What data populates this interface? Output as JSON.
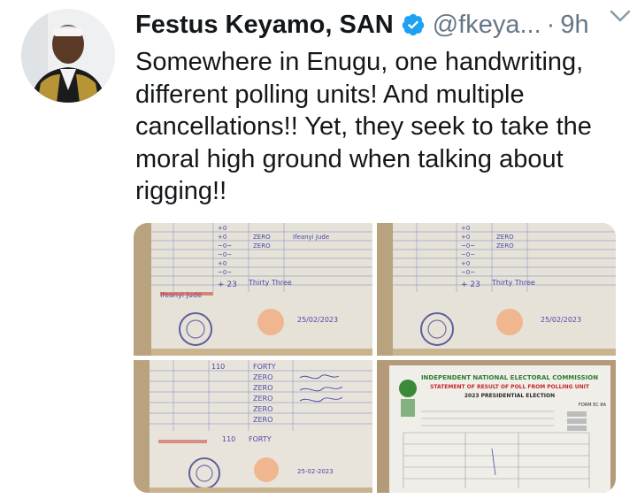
{
  "tweet": {
    "author_name": "Festus Keyamo, SAN",
    "handle": "@fkeya...",
    "separator": "·",
    "timestamp": "9h",
    "text": "Somewhere in Enugu, one handwriting, different polling units! And multiple cancellations!! Yet, they seek to take the moral high ground when talking about rigging!!"
  },
  "media": {
    "photo_1": {
      "written_date": "25/02/2023",
      "signature_note": "Ifeanyi Jude"
    },
    "photo_2": {
      "written_date": "25/02/2023"
    },
    "photo_3": {
      "entries": [
        "110",
        "FORTY",
        "ZERO",
        "ZERO",
        "ZERO",
        "ZERO",
        "ZERO"
      ],
      "total": "110",
      "total_words": "FORTY",
      "date": "25-02-2023"
    },
    "photo_4": {
      "heading": "INDEPENDENT NATIONAL ELECTORAL COMMISSION",
      "subheading": "STATEMENT OF RESULT OF POLL FROM POLLING UNIT",
      "election": "2023 PRESIDENTIAL ELECTION",
      "form": "FORM EC 8A"
    }
  },
  "colors": {
    "verified_blue": "#1da1f2",
    "secondary_text": "#657786",
    "primary_text": "#14171a"
  },
  "icons": {
    "verified": "verified-badge-icon",
    "caret": "chevron-down-icon"
  }
}
